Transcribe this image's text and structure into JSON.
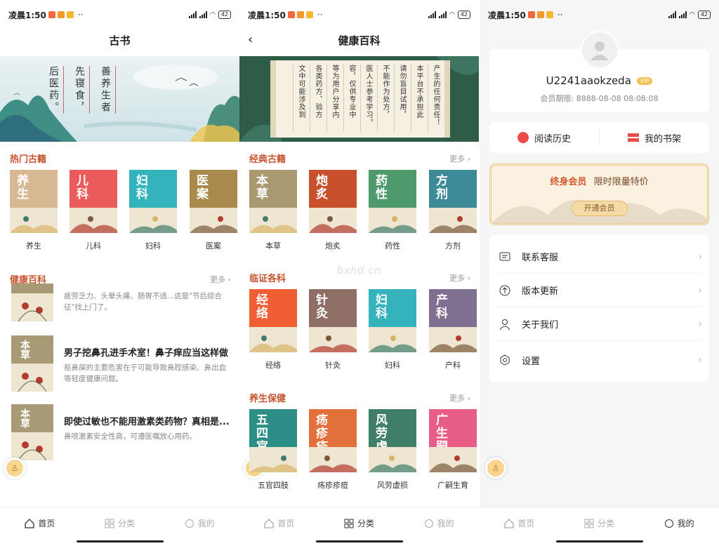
{
  "status": {
    "time": "凌晨1:50",
    "battery": "42",
    "dots": "··"
  },
  "watermark": "bxhd.cn",
  "screen1": {
    "title": "古书",
    "banner_lines": [
      "善养生者",
      "先寝食，",
      "后医药。"
    ],
    "hot_section": {
      "title": "热门古籍"
    },
    "hot_books": [
      {
        "name": "养生",
        "label": "养生",
        "color": "#d7b892"
      },
      {
        "name": "儿科",
        "label": "儿科",
        "color": "#ec5b5b"
      },
      {
        "name": "妇科",
        "label": "妇科",
        "color": "#35b3bc"
      },
      {
        "name": "医案",
        "label": "医案",
        "color": "#a9894c"
      }
    ],
    "health_section": {
      "title": "健康百科",
      "more": "更多"
    },
    "articles": [
      {
        "thumb": "草",
        "title": "",
        "desc": "疲劳乏力、头晕头痛、肠胃不适...这是\"节后综合征\"找上门了。"
      },
      {
        "thumb": "本草",
        "title": "男子挖鼻孔进手术室！鼻子痒应当这样做",
        "desc": "抠鼻屎的主要危害在于可能导致鼻腔感染、鼻出血等轻度健康问题。"
      },
      {
        "thumb": "本草",
        "title": "即使过敏也不能用激素类药物？真相是...",
        "desc": "鼻喷激素安全性高，可遵医嘱放心用药。"
      }
    ]
  },
  "screen2": {
    "title": "健康百科",
    "scroll_lines": [
      "文中可能涉及到",
      "各类药方、验方",
      "等为用户分享内",
      "容，仅供专业中",
      "医人士参考学习。",
      "不能作为处方，",
      "请勿盲目试用，",
      "本平台不承担此",
      "产生的任何责任！"
    ],
    "sections": [
      {
        "title": "经典古籍",
        "more": "更多",
        "books": [
          {
            "name": "本草",
            "label": "本草",
            "color": "#a99870"
          },
          {
            "name": "炮炙",
            "label": "炮炙",
            "color": "#c9502d"
          },
          {
            "name": "药性",
            "label": "药性",
            "color": "#4e9a6d"
          },
          {
            "name": "方剂",
            "label": "方剂",
            "color": "#3d8a98"
          }
        ]
      },
      {
        "title": "临证各科",
        "more": "更多",
        "books": [
          {
            "name": "经络",
            "label": "经络",
            "color": "#f05f34"
          },
          {
            "name": "针灸",
            "label": "针灸",
            "color": "#8f6e66"
          },
          {
            "name": "妇科",
            "label": "妇科",
            "color": "#35b3bc"
          },
          {
            "name": "产科",
            "label": "产科",
            "color": "#7f7092"
          }
        ]
      },
      {
        "title": "养生保健",
        "more": "更多",
        "books": [
          {
            "name": "五四官肢",
            "label": "五官四肢",
            "color": "#2c8e86"
          },
          {
            "name": "疡疹疹痘",
            "label": "疡疹疹痘",
            "color": "#e2703a"
          },
          {
            "name": "风劳虚损",
            "label": "风劳虚损",
            "color": "#3f7e68"
          },
          {
            "name": "广生嗣育",
            "label": "广嗣生育",
            "color": "#e85d85"
          }
        ]
      }
    ]
  },
  "screen3": {
    "username": "U2241aaokzeda",
    "vip_badge": "VIP",
    "member_expiry": "会员期限: 8888-08-08 08:08:08",
    "history": "阅读历史",
    "bookshelf": "我的书架",
    "promo": {
      "title": "终身会员",
      "subtitle": "限时限量特价",
      "button": "开通会员"
    },
    "menu": [
      {
        "label": "联系客服",
        "icon": "chat-icon"
      },
      {
        "label": "版本更新",
        "icon": "upload-icon"
      },
      {
        "label": "关于我们",
        "icon": "person-icon"
      },
      {
        "label": "设置",
        "icon": "settings-icon"
      }
    ]
  },
  "tabs": [
    {
      "label": "首页",
      "icon": "home-icon"
    },
    {
      "label": "分类",
      "icon": "grid-icon"
    },
    {
      "label": "我的",
      "icon": "profile-icon"
    }
  ]
}
